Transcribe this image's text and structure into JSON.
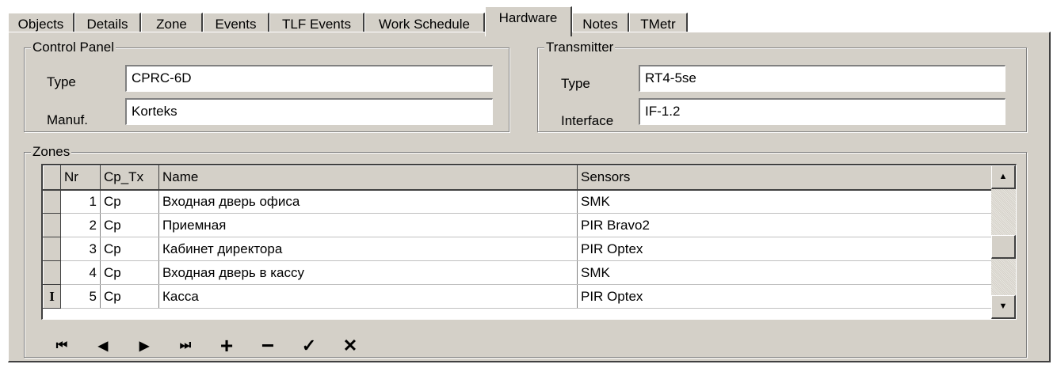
{
  "tabs": [
    {
      "label": "Objects"
    },
    {
      "label": "Details"
    },
    {
      "label": "Zone"
    },
    {
      "label": "Events"
    },
    {
      "label": "TLF Events"
    },
    {
      "label": "Work Schedule"
    },
    {
      "label": "Hardware",
      "active": true
    },
    {
      "label": "Notes"
    },
    {
      "label": "TMetr"
    }
  ],
  "control_panel": {
    "title": "Control Panel",
    "type_label": "Type",
    "type_value": "CPRC-6D",
    "manuf_label": "Manuf.",
    "manuf_value": "Korteks"
  },
  "transmitter": {
    "title": "Transmitter",
    "type_label": "Type",
    "type_value": "RT4-5se",
    "interface_label": "Interface",
    "interface_value": "IF-1.2"
  },
  "zones": {
    "title": "Zones",
    "columns": [
      "Nr",
      "Cp_Tx",
      "Name",
      "Sensors"
    ],
    "rows": [
      {
        "nr": "1",
        "cp_tx": "Cp",
        "name": "Входная дверь офиса",
        "sensors": "SMK"
      },
      {
        "nr": "2",
        "cp_tx": "Cp",
        "name": "Приемная",
        "sensors": "PIR Bravo2"
      },
      {
        "nr": "3",
        "cp_tx": "Cp",
        "name": "Кабинет директора",
        "sensors": "PIR Optex"
      },
      {
        "nr": "4",
        "cp_tx": "Cp",
        "name": "Входная дверь в кассу",
        "sensors": "SMK"
      },
      {
        "nr": "5",
        "cp_tx": "Cp",
        "name": "Касса",
        "sensors": "PIR Optex"
      }
    ],
    "current_row_indicator": "I"
  },
  "navigator": {
    "first": "⏮",
    "prior": "◀",
    "next": "▶",
    "last": "⏭",
    "insert": "+",
    "delete": "−",
    "post": "✓",
    "cancel": "✕"
  }
}
